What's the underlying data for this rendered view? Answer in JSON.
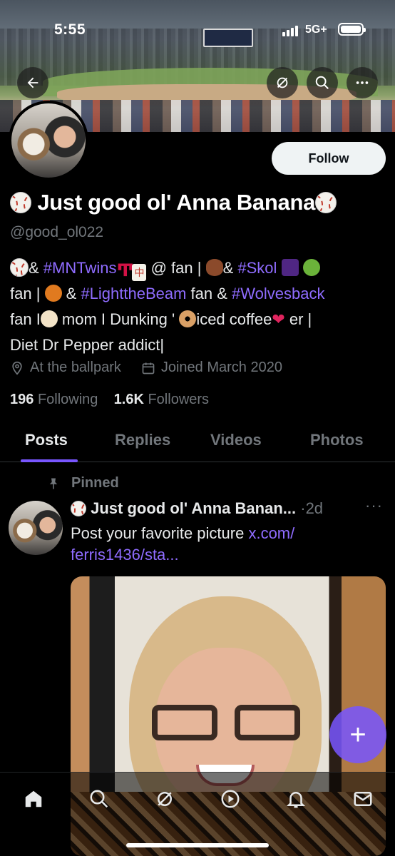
{
  "status_bar": {
    "time": "5:55",
    "network": "5G+"
  },
  "header": {
    "back_icon": "back-arrow-icon",
    "grok_icon": "grok-icon",
    "search_icon": "search-icon",
    "more_icon": "more-icon"
  },
  "profile": {
    "follow_label": "Follow",
    "name": "Just good ol' Anna Banana",
    "handle": "@good_ol022",
    "bio": {
      "seg_amp1": "& ",
      "tag_mntwins": "#MNTwins",
      "seg_fan1": " @ fan | ",
      "seg_amp2": "& ",
      "tag_skol": "#Skol",
      "seg_fan2": "fan | ",
      "seg_amp3": " & ",
      "tag_lightthebeam": "#LighttheBeam",
      "seg_fan3": " fan & ",
      "tag_wolvesback": "#Wolvesback",
      "seg_fan4": "fan I",
      "seg_mom": " mom I Dunking '",
      "seg_iced": "iced coffee",
      "seg_er": " er |",
      "seg_diet": "Diet Dr Pepper addict|"
    },
    "location": "At the ballpark",
    "joined": "Joined March 2020",
    "following_count": "196",
    "following_label": "Following",
    "followers_count": "1.6K",
    "followers_label": "Followers"
  },
  "tabs": [
    {
      "label": "Posts",
      "active": true
    },
    {
      "label": "Replies",
      "active": false
    },
    {
      "label": "Videos",
      "active": false
    },
    {
      "label": "Photos",
      "active": false
    }
  ],
  "post": {
    "pinned_label": "Pinned",
    "author": "Just good ol' Anna Banan...",
    "sep": "·",
    "time": "2d",
    "more": "···",
    "text": "Post your favorite picture ",
    "link": "x.com/ ferris1436/sta..."
  },
  "fab_label": "+",
  "bottom_nav": [
    "home-icon",
    "search-icon",
    "grok-icon",
    "spaces-icon",
    "notifications-icon",
    "messages-icon"
  ],
  "colors": {
    "accent": "#7856ff",
    "link": "#8f6cff",
    "muted": "#71767b",
    "text": "#e7e9ea",
    "background": "#000000"
  }
}
